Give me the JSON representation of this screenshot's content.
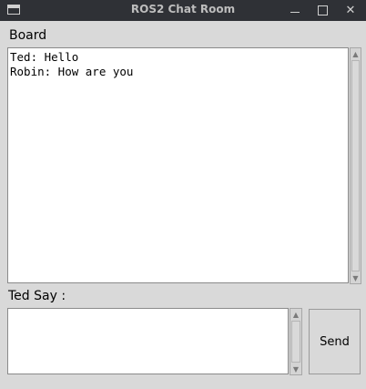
{
  "window": {
    "title": "ROS2 Chat Room",
    "controls": {
      "minimize": "minimize-icon",
      "maximize": "maximize-icon",
      "close": "✕"
    }
  },
  "board": {
    "label": "Board",
    "messages": [
      "Ted: Hello",
      "Robin: How are you"
    ]
  },
  "say": {
    "label": "Ted Say :",
    "value": "",
    "placeholder": ""
  },
  "send": {
    "label": "Send"
  }
}
